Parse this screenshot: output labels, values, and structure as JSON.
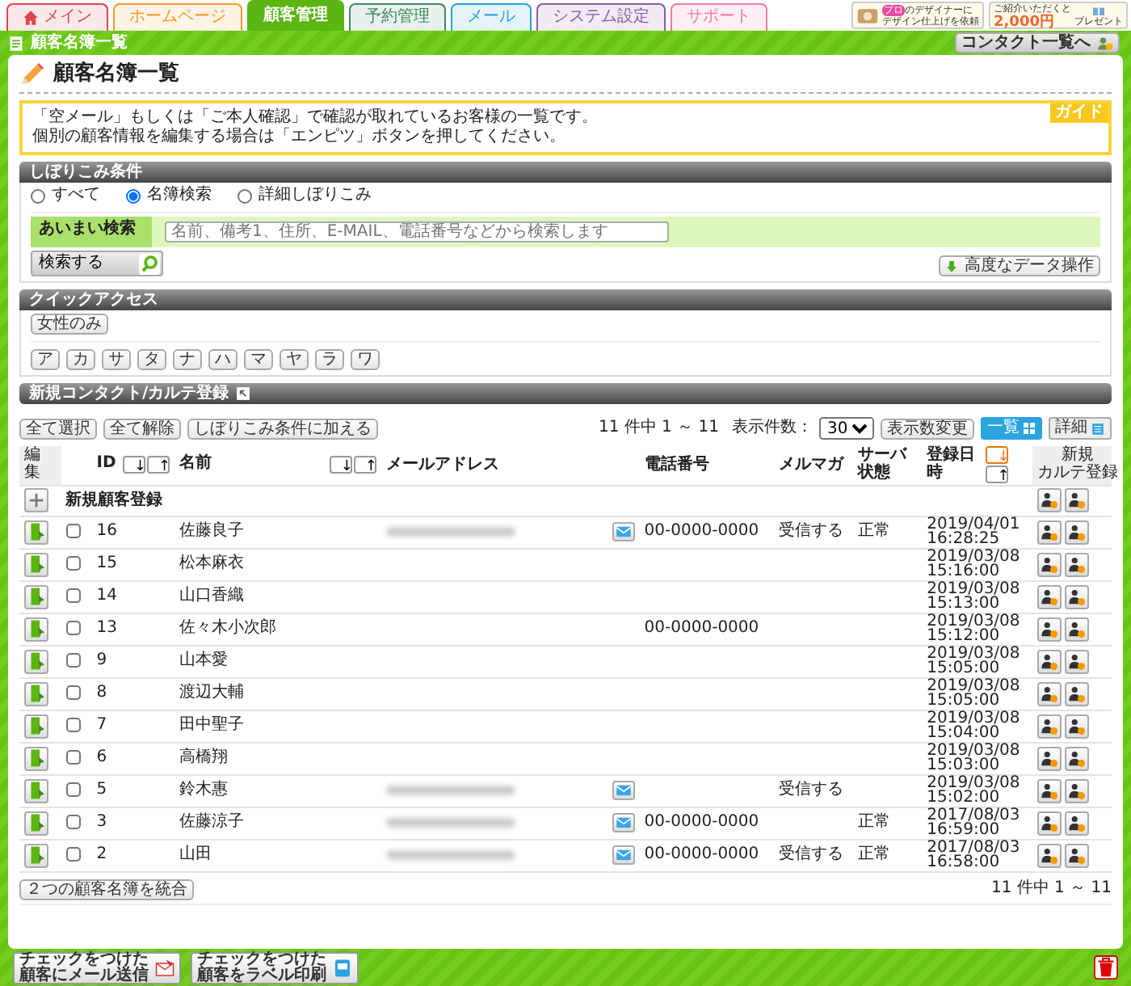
{
  "tabs": [
    {
      "label": "メイン",
      "kind": "home",
      "color": "#e0454a",
      "selected": false
    },
    {
      "label": "ホームページ",
      "kind": "text",
      "color": "#f39a2b",
      "selected": false
    },
    {
      "label": "顧客管理",
      "kind": "text",
      "color": "#5bb512",
      "selected": true
    },
    {
      "label": "予約管理",
      "kind": "text",
      "color": "#3f8a5c",
      "selected": false
    },
    {
      "label": "メール",
      "kind": "text",
      "color": "#2aa3de",
      "selected": false
    },
    {
      "label": "システム設定",
      "kind": "text",
      "color": "#8c5aa8",
      "selected": false
    },
    {
      "label": "サポート",
      "kind": "text",
      "color": "#f07aa0",
      "selected": false
    }
  ],
  "promos": {
    "designer": {
      "badge": "プロ",
      "line1": "のデザイナーに",
      "line2": "デザイン仕上げを依頼"
    },
    "referral": {
      "line1": "ご紹介いただくと",
      "amount": "2,000円",
      "line2": "プレゼント"
    }
  },
  "header_bar": {
    "title": "顧客名簿一覧",
    "button": "コンタクト一覧へ"
  },
  "page_title": "顧客名簿一覧",
  "guide": {
    "tag": "ガイド",
    "lines": [
      "「空メール」もしくは「ご本人確認」で確認が取れているお客様の一覧です。",
      "個別の顧客情報を編集する場合は「エンピツ」ボタンを押してください。"
    ]
  },
  "filter": {
    "title": "しぼりこみ条件",
    "modes": [
      {
        "label": "すべて",
        "selected": false
      },
      {
        "label": "名簿検索",
        "selected": true
      },
      {
        "label": "詳細しぼりこみ",
        "selected": false
      }
    ],
    "fuzzy_label": "あいまい検索",
    "placeholder": "名前、備考1、住所、E-MAIL、電話番号などから検索します",
    "search_button": "検索する",
    "advanced_button": "高度なデータ操作"
  },
  "quick_access": {
    "title": "クイックアクセス",
    "filters": [
      "女性のみ"
    ],
    "kana": [
      "ア",
      "カ",
      "サ",
      "タ",
      "ナ",
      "ハ",
      "マ",
      "ヤ",
      "ラ",
      "ワ"
    ]
  },
  "new_contact": {
    "title": "新規コンタクト/カルテ登録"
  },
  "toolbar": {
    "buttons": [
      "全て選択",
      "全て解除",
      "しぼりこみ条件に加える"
    ],
    "count": "11 件中 1 ～ 11",
    "per_page_label": "表示件数：",
    "per_page": "30",
    "apply_button": "表示数変更",
    "views": [
      {
        "label": "一覧",
        "selected": true
      },
      {
        "label": "詳細",
        "selected": false
      }
    ]
  },
  "table": {
    "columns": [
      {
        "label": "編集"
      },
      {
        "label": "ID",
        "sort": [
          {
            "label": "↓",
            "active": false
          },
          {
            "label": "↑",
            "active": false
          }
        ]
      },
      {
        "label": "名前",
        "sort": [
          {
            "label": "↓",
            "active": false
          },
          {
            "label": "↑",
            "active": false
          }
        ]
      },
      {
        "label": "メールアドレス"
      },
      {
        "label": "電話番号"
      },
      {
        "label": "メルマガ"
      },
      {
        "lines": [
          "サーバ",
          "状態"
        ]
      },
      {
        "label": "登録日時",
        "sort": [
          {
            "label": "↓",
            "active": true
          },
          {
            "label": "↑",
            "active": false
          }
        ]
      },
      {
        "lines": [
          "新規",
          "カルテ登録"
        ]
      }
    ],
    "new_row": {
      "label": "新規顧客登録"
    },
    "rows": [
      {
        "id": "16",
        "name": "佐藤良子",
        "checked": false,
        "has_email": true,
        "phone": "00-0000-0000",
        "mailmag": "受信する",
        "server": "正常",
        "date": "2019/04/01",
        "time": "16:28:25"
      },
      {
        "id": "15",
        "name": "松本麻衣",
        "checked": false,
        "has_email": false,
        "date": "2019/03/08",
        "time": "15:16:00"
      },
      {
        "id": "14",
        "name": "山口香織",
        "checked": false,
        "has_email": false,
        "date": "2019/03/08",
        "time": "15:13:00"
      },
      {
        "id": "13",
        "name": "佐々木小次郎",
        "checked": false,
        "has_email": false,
        "phone": "00-0000-0000",
        "date": "2019/03/08",
        "time": "15:12:00"
      },
      {
        "id": "9",
        "name": "山本愛",
        "checked": false,
        "has_email": false,
        "date": "2019/03/08",
        "time": "15:05:00"
      },
      {
        "id": "8",
        "name": "渡辺大輔",
        "checked": false,
        "has_email": false,
        "date": "2019/03/08",
        "time": "15:05:00"
      },
      {
        "id": "7",
        "name": "田中聖子",
        "checked": false,
        "has_email": false,
        "date": "2019/03/08",
        "time": "15:04:00"
      },
      {
        "id": "6",
        "name": "高橋翔",
        "checked": false,
        "has_email": false,
        "date": "2019/03/08",
        "time": "15:03:00"
      },
      {
        "id": "5",
        "name": "鈴木惠",
        "checked": false,
        "has_email": true,
        "mailmag": "受信する",
        "date": "2019/03/08",
        "time": "15:02:00"
      },
      {
        "id": "3",
        "name": "佐藤涼子",
        "checked": false,
        "has_email": true,
        "phone": "00-0000-0000",
        "server": "正常",
        "date": "2017/08/03",
        "time": "16:59:00"
      },
      {
        "id": "2",
        "name": "山田",
        "checked": false,
        "has_email": true,
        "phone": "00-0000-0000",
        "mailmag": "受信する",
        "server": "正常",
        "date": "2017/08/03",
        "time": "16:58:00"
      }
    ]
  },
  "footer": {
    "merge_button": "２つの顧客名簿を統合",
    "count": "11 件中 1 ～ 11"
  },
  "bottom_bar": {
    "buttons": [
      {
        "kind": "mail",
        "line1": "チェックをつけた",
        "line2": "顧客にメール送信"
      },
      {
        "kind": "label",
        "line1": "チェックをつけた",
        "line2": "顧客をラベル印刷"
      }
    ]
  }
}
